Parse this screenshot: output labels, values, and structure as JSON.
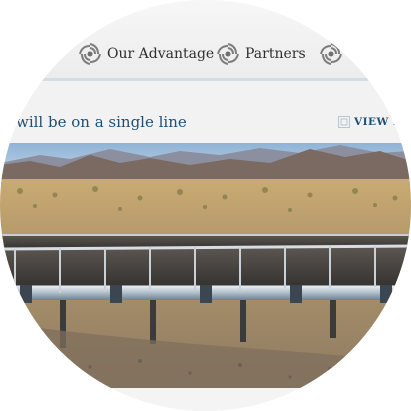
{
  "nav": {
    "items": [
      {
        "label": "",
        "icon": "swirl-logo-icon"
      },
      {
        "label": "Our Advantage",
        "icon": "swirl-logo-icon"
      },
      {
        "label": "Partners",
        "icon": "swirl-logo-icon"
      },
      {
        "label": "",
        "icon": "swirl-logo-icon"
      }
    ]
  },
  "banner": {
    "title": "will be on a single line",
    "view_link": "VIEW FU",
    "view_icon": "grid-icon"
  },
  "hero": {
    "subject": "solar-trough-collectors-photo"
  },
  "colors": {
    "link_blue": "#1f4e74",
    "nav_text": "#2f2f2f",
    "sky": "#8fb3d6",
    "mountains": "#7a6a62",
    "ground": "#b89a6a"
  }
}
